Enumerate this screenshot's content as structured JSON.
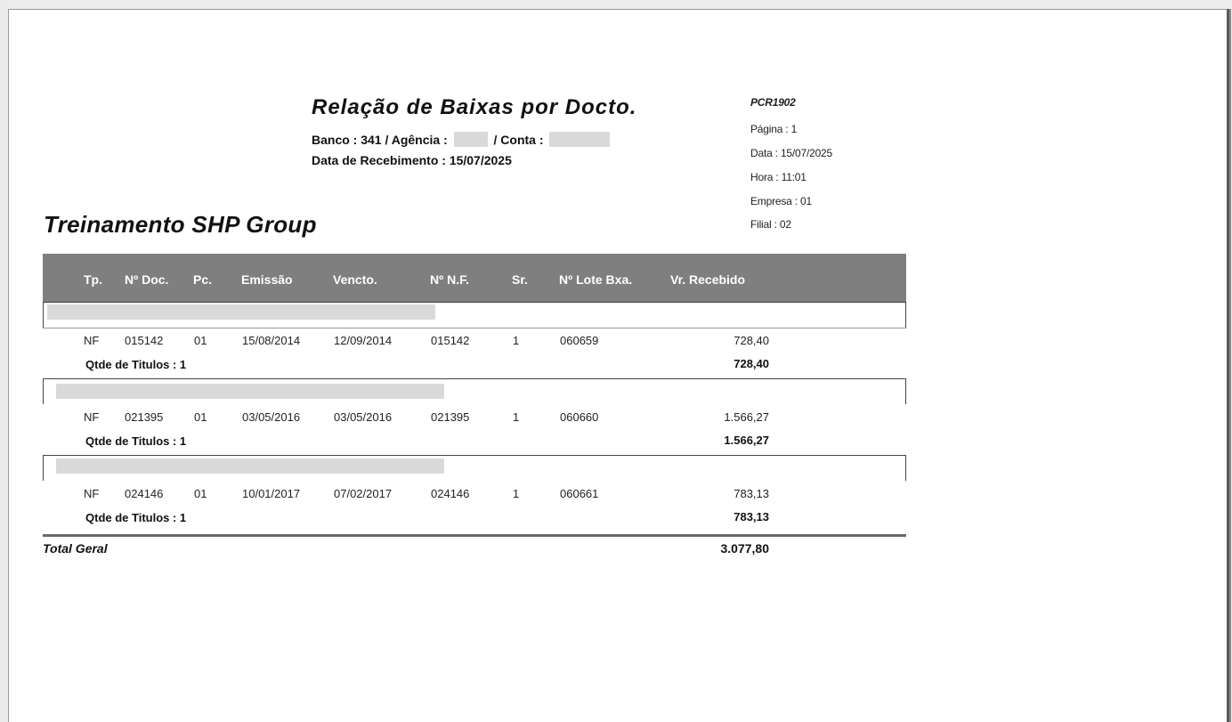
{
  "report": {
    "title": "Relação de Baixas por Docto.",
    "bank_line_prefix": "Banco : 341 / Agência :",
    "bank_line_mid": "/ Conta :",
    "date_line": "Data de Recebimento : 15/07/2025",
    "company": "Treinamento SHP Group"
  },
  "meta": {
    "code": "PCR1902",
    "page": "Página : 1",
    "date": "Data : 15/07/2025",
    "time": "Hora : 11:01",
    "empresa": "Empresa : 01",
    "filial": "Filial : 02"
  },
  "columns": {
    "tp": "Tp.",
    "doc": "Nº Doc.",
    "pc": "Pc.",
    "emissao": "Emissão",
    "vencto": "Vencto.",
    "nf": "Nº N.F.",
    "sr": "Sr.",
    "lote": "Nº Lote Bxa.",
    "valor": "Vr. Recebido"
  },
  "groups": [
    {
      "row": {
        "tp": "NF",
        "doc": "015142",
        "pc": "01",
        "emissao": "15/08/2014",
        "vencto": "12/09/2014",
        "nf": "015142",
        "sr": "1",
        "lote": "060659",
        "valor": "728,40"
      },
      "qtde_label": "Qtde de Titulos : 1",
      "subtotal": "728,40"
    },
    {
      "row": {
        "tp": "NF",
        "doc": "021395",
        "pc": "01",
        "emissao": "03/05/2016",
        "vencto": "03/05/2016",
        "nf": "021395",
        "sr": "1",
        "lote": "060660",
        "valor": "1.566,27"
      },
      "qtde_label": "Qtde de Titulos : 1",
      "subtotal": "1.566,27"
    },
    {
      "row": {
        "tp": "NF",
        "doc": "024146",
        "pc": "01",
        "emissao": "10/01/2017",
        "vencto": "07/02/2017",
        "nf": "024146",
        "sr": "1",
        "lote": "060661",
        "valor": "783,13"
      },
      "qtde_label": "Qtde de Titulos : 1",
      "subtotal": "783,13"
    }
  ],
  "total": {
    "label": "Total Geral",
    "value": "3.077,80"
  }
}
